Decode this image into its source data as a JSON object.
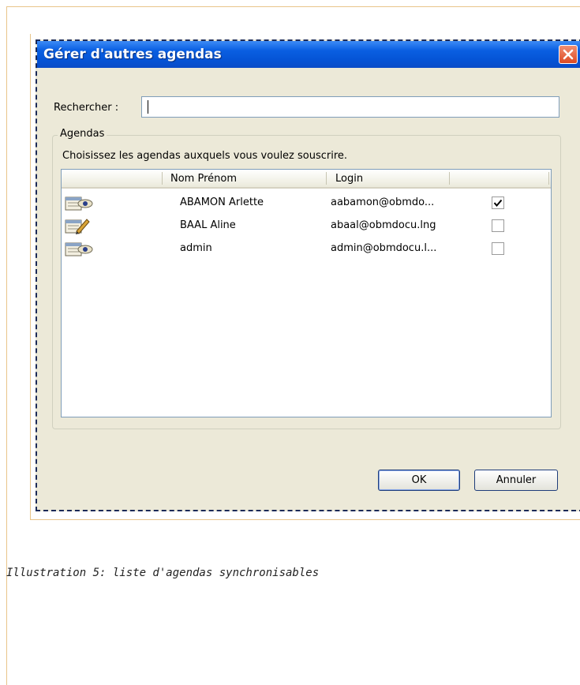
{
  "dialog": {
    "title": "Gérer d'autres agendas",
    "close_icon": "close-icon",
    "search": {
      "label": "Rechercher :",
      "value": "",
      "placeholder": ""
    },
    "group": {
      "legend": "Agendas",
      "instructions": "Choisissez les agendas auxquels vous voulez souscrire."
    },
    "list": {
      "columns": [
        "",
        "Nom Prénom",
        "Login",
        ""
      ],
      "rows": [
        {
          "icon": "calendar-view-icon",
          "name": "ABAMON Arlette",
          "login": "aabamon@obmdo...",
          "checked": true
        },
        {
          "icon": "calendar-edit-icon",
          "name": "BAAL Aline",
          "login": "abaal@obmdocu.lng",
          "checked": false
        },
        {
          "icon": "calendar-view-icon",
          "name": "admin",
          "login": "admin@obmdocu.l...",
          "checked": false
        }
      ]
    },
    "buttons": {
      "ok": "OK",
      "cancel": "Annuler"
    }
  },
  "caption": "Illustration 5: liste d'agendas synchronisables",
  "colors": {
    "titlebar": "#0554d6",
    "dialog_bg": "#ece9d8",
    "close": "#dd4a23"
  }
}
